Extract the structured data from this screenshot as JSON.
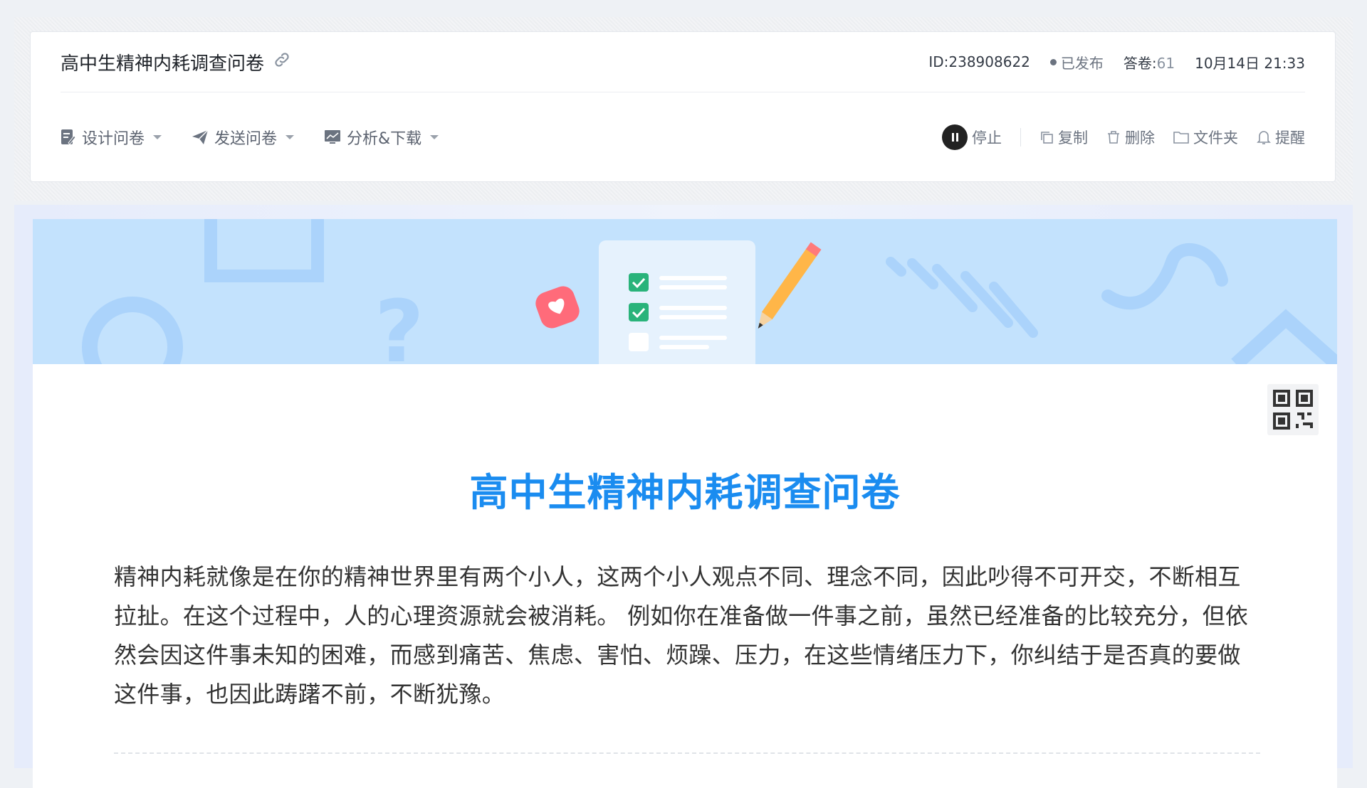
{
  "header": {
    "survey_name": "高中生精神内耗调查问卷",
    "id_text": "ID:238908622",
    "status": "已发布",
    "answers_label": "答卷:",
    "answers_count": "61",
    "datetime": "10月14日 21:33"
  },
  "menus": {
    "design": "设计问卷",
    "send": "发送问卷",
    "analyze": "分析&下载"
  },
  "actions": {
    "stop": "停止",
    "copy": "复制",
    "delete": "删除",
    "folder": "文件夹",
    "remind": "提醒"
  },
  "survey": {
    "title": "高中生精神内耗调查问卷",
    "description": "精神内耗就像是在你的精神世界里有两个小人，这两个小人观点不同、理念不同，因此吵得不可开交，不断相互拉扯。在这个过程中，人的心理资源就会被消耗。 例如你在准备做一件事之前，虽然已经准备的比较充分，但依然会因这件事未知的困难，而感到痛苦、焦虑、害怕、烦躁、压力，在这些情绪压力下，你纠结于是否真的要做这件事，也因此踌躇不前，不断犹豫。"
  },
  "colors": {
    "accent": "#1a8cf0",
    "banner": "#c3e2fd"
  }
}
